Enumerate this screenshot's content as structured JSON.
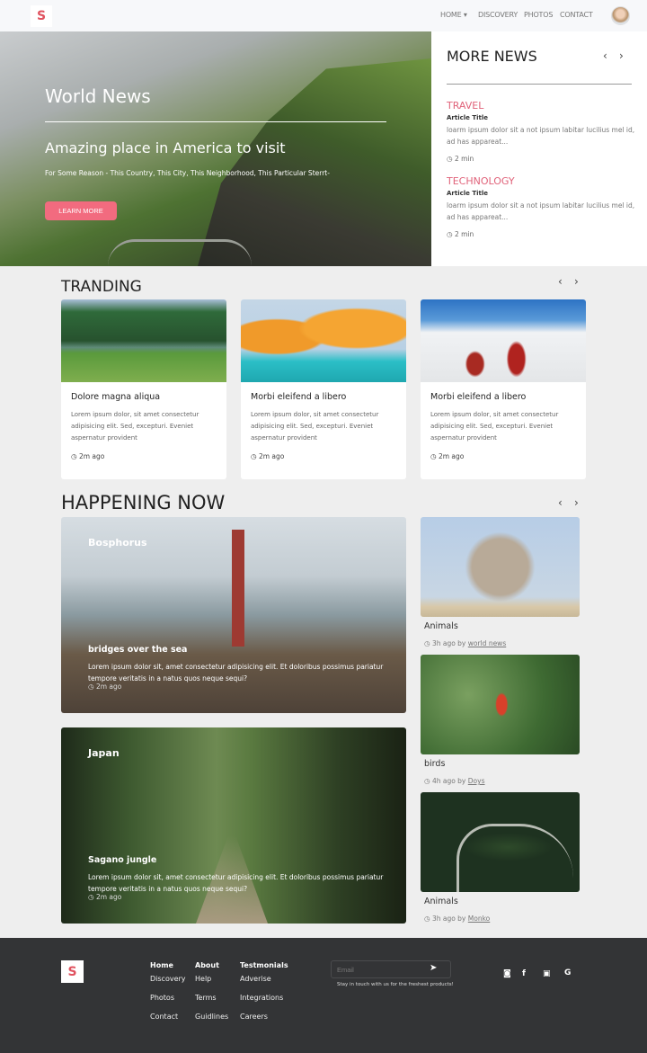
{
  "nav": {
    "logo": "S",
    "links": [
      "HOME ▾",
      "DISCOVERY",
      "PHOTOS",
      "CONTACT"
    ]
  },
  "hero": {
    "title": "World News",
    "headline": "Amazing place in America to visit",
    "subtitle": "For Some Reason - This Country, This City, This Neighborhood, This Particular Sterrt-",
    "button": "LEARN MORE"
  },
  "more_news": {
    "title": "MORE NEWS",
    "prev": "‹",
    "next": "›",
    "items": [
      {
        "category": "TRAVEL",
        "title": "Article Title",
        "desc": "loarm ipsum dolor sit a not ipsum labitar lucilius mel id, ad has appareat...",
        "time": "2 min"
      },
      {
        "category": "TECHNOLOGY",
        "title": "Article Title",
        "desc": "loarm ipsum dolor sit a not ipsum labitar lucilius mel id, ad has appareat...",
        "time": "2 min"
      }
    ]
  },
  "trending": {
    "title": "TRANDING",
    "prev": "‹",
    "next": "›",
    "cards": [
      {
        "title": "Dolore magna aliqua",
        "desc": "Lorem ipsum dolor, sit amet consectetur adipisicing elit. Sed, excepturi. Eveniet aspernatur provident",
        "time": "2m ago"
      },
      {
        "title": "Morbi eleifend a libero",
        "desc": "Lorem ipsum dolor, sit amet consectetur adipisicing elit. Sed, excepturi. Eveniet aspernatur provident",
        "time": "2m ago"
      },
      {
        "title": "Morbi eleifend a libero",
        "desc": "Lorem ipsum dolor, sit amet consectetur adipisicing elit. Sed, excepturi. Eveniet aspernatur provident",
        "time": "2m ago"
      }
    ]
  },
  "happening": {
    "title": "HAPPENING NOW",
    "prev": "‹",
    "next": "›",
    "big": [
      {
        "location": "Bosphorus",
        "title": "bridges over the sea",
        "desc": "Lorem ipsum dolor sit, amet consectetur adipisicing elit. Et doloribus possimus pariatur tempore veritatis in a natus quos neque sequi?",
        "time": "2m ago"
      },
      {
        "location": "Japan",
        "title": "Sagano jungle",
        "desc": "Lorem ipsum dolor sit, amet consectetur adipisicing elit. Et doloribus possimus pariatur tempore veritatis in a natus quos neque sequi?",
        "time": "2m ago"
      }
    ],
    "small": [
      {
        "title": "Animals",
        "time": "3h ago by",
        "author": "world news"
      },
      {
        "title": "birds",
        "time": "4h ago by",
        "author": "Doys"
      },
      {
        "title": "Animals",
        "time": "3h ago by",
        "author": "Monko"
      }
    ]
  },
  "footer": {
    "logo": "S",
    "columns": [
      {
        "heading": "Home",
        "links": [
          "Discovery",
          "Photos",
          "Contact"
        ]
      },
      {
        "heading": "About",
        "links": [
          "Help",
          "Terms",
          "Guidlines"
        ]
      },
      {
        "heading": "Testmonials",
        "links": [
          "Adverise",
          "Integrations",
          "Careers"
        ]
      }
    ],
    "email_placeholder": "Email",
    "tagline": "Stay in touch with us for the freshest products!",
    "social": [
      "instagram-icon",
      "facebook-icon",
      "twitter-icon",
      "google-icon"
    ]
  },
  "colors": {
    "accent": "#f26b7f",
    "category": "#e0637a",
    "footer_bg": "#333436",
    "page_bg": "#eeeeee"
  }
}
